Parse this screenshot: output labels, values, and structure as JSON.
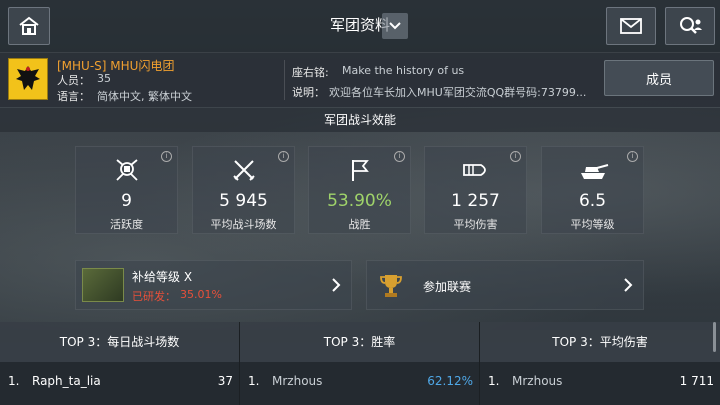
{
  "header": {
    "title": "军团资料"
  },
  "clan": {
    "name": "[MHU-S] MHU闪电团",
    "members_label": "人员：",
    "members": "35",
    "language_label": "语言：",
    "languages": "简体中文, 繁体中文",
    "motto_label": "座右铭:",
    "motto": "Make the history of us",
    "desc_label": "说明：",
    "desc": "欢迎各位车长加入MHU军团交流QQ群号码:73799...",
    "members_button": "成员"
  },
  "stats": {
    "section_title": "军团战斗效能",
    "cards": [
      {
        "value": "9",
        "label": "活跃度",
        "icon": "activity-icon"
      },
      {
        "value": "5 945",
        "label": "平均战斗场数",
        "icon": "crossed-swords-icon"
      },
      {
        "value": "53.90%",
        "label": "战胜",
        "icon": "flag-icon"
      },
      {
        "value": "1 257",
        "label": "平均伤害",
        "icon": "shell-icon"
      },
      {
        "value": "6.5",
        "label": "平均等级",
        "icon": "tank-icon"
      }
    ]
  },
  "supply": {
    "title": "补给等级 X",
    "progress_label": "已研发：",
    "progress_value": "35.01%"
  },
  "league": {
    "title": "参加联赛"
  },
  "tops": [
    {
      "header": "TOP 3：每日战斗场数",
      "rank": "1.",
      "player": "Raph_ta_lia",
      "value": "37"
    },
    {
      "header": "TOP 3：胜率",
      "rank": "1.",
      "player": "Mrzhous",
      "value": "62.12%"
    },
    {
      "header": "TOP 3：平均伤害",
      "rank": "1.",
      "player": "Mrzhous",
      "value": "1 711"
    }
  ],
  "colors": {
    "accent_orange": "#f0a030",
    "win_green": "#9fd36a",
    "link_blue": "#4fa7e6",
    "progress_red": "#e8503a"
  }
}
